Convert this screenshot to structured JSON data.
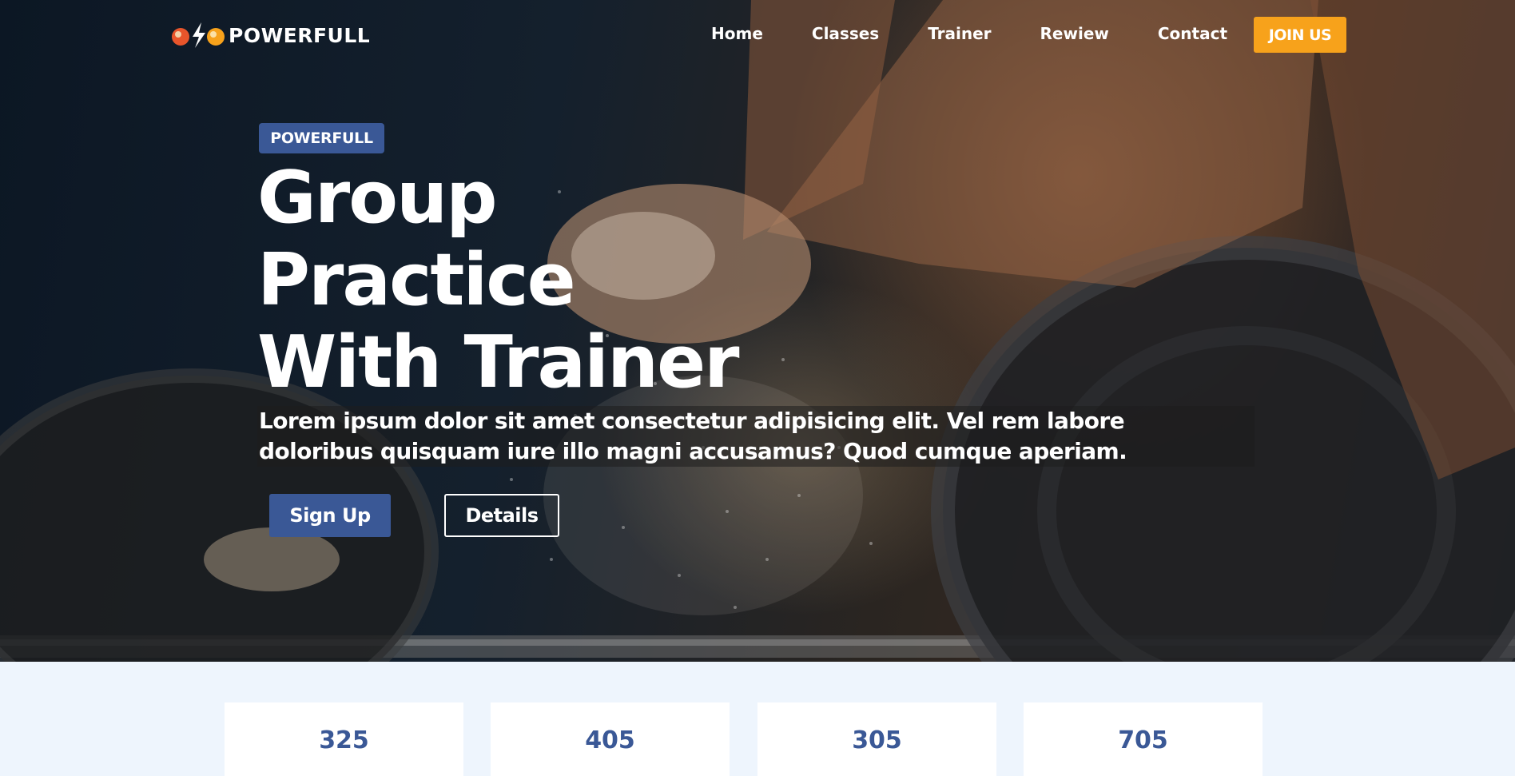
{
  "brand": {
    "name": "POWERFULL"
  },
  "nav": {
    "items": [
      "Home",
      "Classes",
      "Trainer",
      "Rewiew",
      "Contact"
    ],
    "cta": "JOIN US"
  },
  "hero": {
    "badge": "POWERFULL",
    "title_lines": [
      "Group",
      "Practice",
      "With Trainer"
    ],
    "description_lines": [
      "Lorem ipsum dolor sit amet consectetur adipisicing elit. Vel rem labore",
      "doloribus quisquam iure illo magni accusamus? Quod cumque aperiam."
    ],
    "primary_button": "Sign Up",
    "secondary_button": "Details"
  },
  "stats": {
    "values": [
      "325",
      "405",
      "305",
      "705"
    ]
  },
  "colors": {
    "accent": "#f7a21b",
    "brand_blue": "#3a5896",
    "section_bg": "#eef5fd"
  }
}
